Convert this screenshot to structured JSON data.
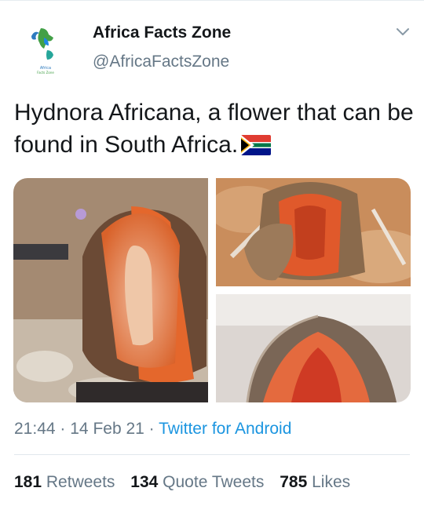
{
  "author": {
    "name": "Africa Facts Zone",
    "handle": "@AfricaFactsZone",
    "avatar_logo_text": "Africa Facts Zone"
  },
  "tweet": {
    "text": "Hydnora Africana, a flower that can be found in South Africa.",
    "flag_icon": "south-africa-flag-emoji"
  },
  "media": {
    "photo_count": 3
  },
  "meta": {
    "time": "21:44",
    "separator": "·",
    "date": "14 Feb 21",
    "source": "Twitter for Android"
  },
  "stats": [
    {
      "count": "181",
      "label": "Retweets"
    },
    {
      "count": "134",
      "label": "Quote Tweets"
    },
    {
      "count": "785",
      "label": "Likes"
    }
  ],
  "colors": {
    "text": "#14171a",
    "secondary": "#657786",
    "link": "#1b95e0",
    "divider": "#e1e8ed"
  }
}
